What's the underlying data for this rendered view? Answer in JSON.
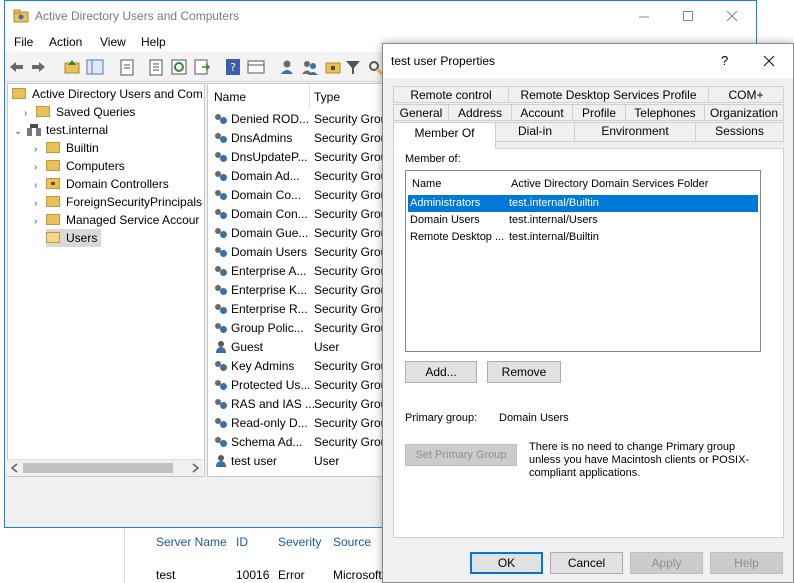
{
  "aduc": {
    "title": "Active Directory Users and Computers",
    "menu": [
      "File",
      "Action",
      "View",
      "Help"
    ],
    "tree": [
      {
        "label": "Active Directory Users and Com",
        "level": 0,
        "expander": ""
      },
      {
        "label": "Saved Queries",
        "level": 1,
        "expander": "›"
      },
      {
        "label": "test.internal",
        "level": 1,
        "expander": "⌄"
      },
      {
        "label": "Builtin",
        "level": 2,
        "expander": "›"
      },
      {
        "label": "Computers",
        "level": 2,
        "expander": "›"
      },
      {
        "label": "Domain Controllers",
        "level": 2,
        "expander": "›"
      },
      {
        "label": "ForeignSecurityPrincipals",
        "level": 2,
        "expander": "›"
      },
      {
        "label": "Managed Service Accour",
        "level": 2,
        "expander": "›"
      },
      {
        "label": "Users",
        "level": 2,
        "expander": ""
      }
    ],
    "list_columns": [
      "Name",
      "Type"
    ],
    "list_rows": [
      {
        "name": "Denied ROD...",
        "type": "Security Group",
        "icon": "group"
      },
      {
        "name": "DnsAdmins",
        "type": "Security Group",
        "icon": "group"
      },
      {
        "name": "DnsUpdateP...",
        "type": "Security Group",
        "icon": "group"
      },
      {
        "name": "Domain Ad...",
        "type": "Security Group",
        "icon": "group"
      },
      {
        "name": "Domain Co...",
        "type": "Security Group",
        "icon": "group"
      },
      {
        "name": "Domain Con...",
        "type": "Security Group",
        "icon": "group"
      },
      {
        "name": "Domain Gue...",
        "type": "Security Group",
        "icon": "group"
      },
      {
        "name": "Domain Users",
        "type": "Security Group",
        "icon": "group"
      },
      {
        "name": "Enterprise A...",
        "type": "Security Group",
        "icon": "group"
      },
      {
        "name": "Enterprise K...",
        "type": "Security Group",
        "icon": "group"
      },
      {
        "name": "Enterprise R...",
        "type": "Security Group",
        "icon": "group"
      },
      {
        "name": "Group Polic...",
        "type": "Security Group",
        "icon": "group"
      },
      {
        "name": "Guest",
        "type": "User",
        "icon": "user"
      },
      {
        "name": "Key Admins",
        "type": "Security Group",
        "icon": "group"
      },
      {
        "name": "Protected Us...",
        "type": "Security Group",
        "icon": "group"
      },
      {
        "name": "RAS and IAS ...",
        "type": "Security Group",
        "icon": "group"
      },
      {
        "name": "Read-only D...",
        "type": "Security Group",
        "icon": "group"
      },
      {
        "name": "Schema Ad...",
        "type": "Security Group",
        "icon": "group"
      },
      {
        "name": "test user",
        "type": "User",
        "icon": "user"
      }
    ]
  },
  "event_list": {
    "columns": [
      "Server Name",
      "ID",
      "Severity",
      "Source"
    ],
    "row": [
      "test",
      "10016",
      "Error",
      "Microsoft"
    ]
  },
  "dialog": {
    "title": "test user Properties",
    "help_glyph": "?",
    "tabs_row1": [
      "Remote control",
      "Remote Desktop Services Profile",
      "COM+"
    ],
    "tabs_row2": [
      "General",
      "Address",
      "Account",
      "Profile",
      "Telephones",
      "Organization"
    ],
    "tabs_row3": [
      "Member Of",
      "Dial-in",
      "Environment",
      "Sessions"
    ],
    "member_of_label": "Member of:",
    "columns": [
      "Name",
      "Active Directory Domain Services Folder"
    ],
    "members": [
      {
        "name": "Administrators",
        "folder": "test.internal/Builtin",
        "selected": true
      },
      {
        "name": "Domain Users",
        "folder": "test.internal/Users",
        "selected": false
      },
      {
        "name": "Remote Desktop ...",
        "folder": "test.internal/Builtin",
        "selected": false
      }
    ],
    "add_button": "Add...",
    "remove_button": "Remove",
    "primary_group_label": "Primary group:",
    "primary_group_value": "Domain Users",
    "set_primary_button": "Set Primary Group",
    "primary_note": "There is no need to change Primary group unless you have Macintosh clients or POSIX-compliant applications.",
    "ok_button": "OK",
    "cancel_button": "Cancel",
    "apply_button": "Apply",
    "help_button": "Help"
  },
  "colors": {
    "selection": "#0078d7",
    "window_border": "#1883d7",
    "folder": "#e9c05a"
  }
}
